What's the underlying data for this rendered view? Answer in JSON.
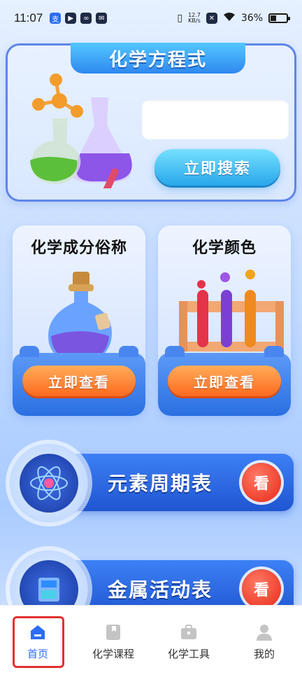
{
  "status_bar": {
    "time": "11:07",
    "net_speed_top": "12.7",
    "net_speed_unit": "KB/s",
    "battery": "36%",
    "battery_level": 0.36
  },
  "top_card": {
    "title": "化学方程式",
    "search_placeholder": "",
    "search_button": "立即搜索"
  },
  "mid_cards": [
    {
      "title": "化学成分俗称",
      "button": "立即查看"
    },
    {
      "title": "化学颜色",
      "button": "立即查看"
    }
  ],
  "list": [
    {
      "label": "元素周期表",
      "action": "看"
    },
    {
      "label": "金属活动表",
      "action": "看"
    }
  ],
  "bottom_nav": [
    {
      "label": "首页",
      "icon": "home-icon",
      "active": true
    },
    {
      "label": "化学课程",
      "icon": "book-icon",
      "active": false
    },
    {
      "label": "化学工具",
      "icon": "toolbox-icon",
      "active": false
    },
    {
      "label": "我的",
      "icon": "user-icon",
      "active": false
    }
  ],
  "colors": {
    "accent": "#2b6df6",
    "orange_button": "#ff6a1f",
    "blue_card": "#2a6fe2",
    "highlight": "#e23030"
  }
}
